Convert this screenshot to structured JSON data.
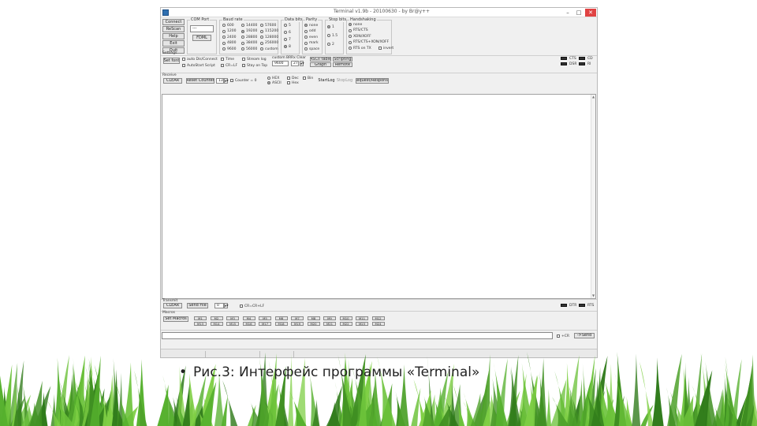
{
  "window": {
    "title": "Terminal v1.9b - 20100630 - by Br@y++",
    "controls": {
      "minimize": "–",
      "maximize": "□",
      "close": "✕"
    }
  },
  "connect_panel": {
    "buttons": [
      "Connect",
      "ReScan",
      "Help",
      "Exit",
      "Quit"
    ]
  },
  "com_port": {
    "title": "COM Port",
    "selected": "---",
    "fdml_button": "FDML"
  },
  "baud_rate": {
    "title": "Baud rate",
    "col1": [
      "600",
      "1200",
      "2400",
      "4800",
      "9600"
    ],
    "col2": [
      "14400",
      "19200",
      "28800",
      "38400",
      "56000"
    ],
    "col3": [
      "57600",
      "115200",
      "128000",
      "256000",
      "custom"
    ],
    "selected": "19200"
  },
  "data_bits": {
    "title": "Data bits",
    "options": [
      "5",
      "6",
      "7",
      "8"
    ],
    "selected": "8"
  },
  "parity": {
    "title": "Parity",
    "options": [
      "none",
      "odd",
      "even",
      "mark",
      "space"
    ],
    "selected": "none"
  },
  "stop_bits": {
    "title": "Stop bits",
    "options": [
      "1",
      "1.5",
      "2"
    ],
    "selected": "1"
  },
  "handshaking": {
    "title": "Handshaking",
    "options": [
      "none",
      "RTS/CTS",
      "XON/XOFF",
      "RTS/CTS+XON/XOFF",
      "RTS on TX"
    ],
    "extra": "invert",
    "selected": "none"
  },
  "settings": {
    "title": "Settings",
    "set_font": "Set font",
    "checks": [
      "auto Dis/Connect",
      "AutoStart Script",
      "Time",
      "CR=LF",
      "Stream log",
      "Stay on Top"
    ],
    "custom_br_label": "custom BR",
    "custom_br_value": "9600",
    "rx_clear_label": "Rx Clear",
    "rx_clear_value": "27",
    "ascii_table": "ASCII table",
    "graph": "Graph",
    "scripting": "Scripting",
    "remote": "Remote"
  },
  "leds": [
    "CTS",
    "CD",
    "DSR",
    "RI"
  ],
  "receive": {
    "title": "Receive",
    "clear": "CLEAR",
    "reset_counter": "Reset Counter",
    "counter_spin": "13",
    "counter_label": "Counter = 0",
    "hex": "HEX",
    "ascii": "ASCII",
    "dec": "Dec",
    "hex2": "Hex",
    "bin": "Bin",
    "start_log": "StartLog",
    "stop_log": "StopLog",
    "request_response": "Request/Response"
  },
  "transmit": {
    "title": "Transmit",
    "clear": "CLEAR",
    "send_file": "Send File",
    "spin_value": "0",
    "cr_lf": "CR=CR+LF",
    "led_labels": [
      "DTR",
      "RTS"
    ]
  },
  "macros": {
    "title": "Macros",
    "set_macros": "Set Macros",
    "row1": [
      "M1",
      "M2",
      "M3",
      "M4",
      "M5",
      "M6",
      "M7",
      "M8",
      "M9",
      "M10",
      "M11",
      "M12"
    ],
    "row2": [
      "M13",
      "M14",
      "M15",
      "M16",
      "M17",
      "M18",
      "M19",
      "M20",
      "M21",
      "M22",
      "M23",
      "M24"
    ]
  },
  "send_row": {
    "crlf": "+CR",
    "send": "->Send"
  },
  "caption": {
    "bullet": "•",
    "text": "Рис.3: Интерфейс программы «Terminal»"
  },
  "colors": {
    "window_bg": "#f0f0f0",
    "close_red": "#e04343",
    "grass_green": "#4ea12a"
  }
}
